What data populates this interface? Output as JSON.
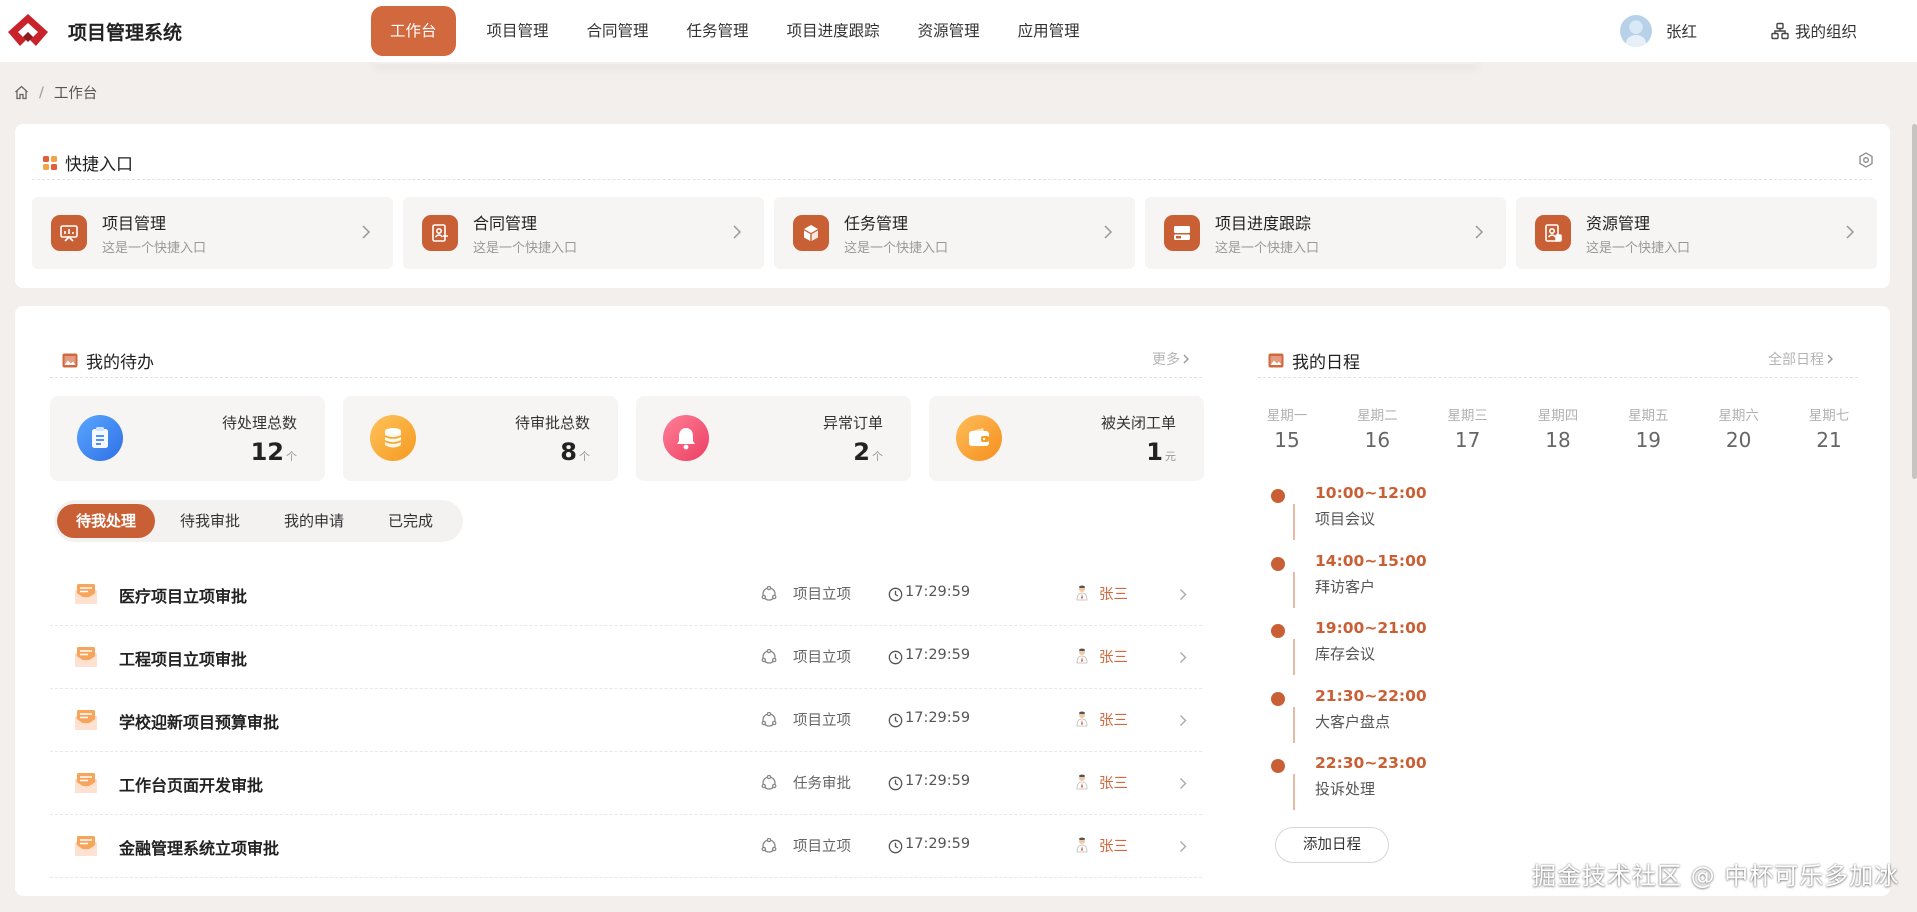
{
  "app": {
    "title": "项目管理系统"
  },
  "nav": {
    "items": [
      "工作台",
      "项目管理",
      "合同管理",
      "任务管理",
      "项目进度跟踪",
      "资源管理",
      "应用管理"
    ]
  },
  "user": {
    "name": "张红",
    "org_label": "我的组织"
  },
  "breadcrumb": {
    "current": "工作台",
    "separator": "/"
  },
  "quick_entry": {
    "title": "快捷入口",
    "items": [
      {
        "title": "项目管理",
        "desc": "这是一个快捷入口",
        "icon": "chart-board-icon"
      },
      {
        "title": "合同管理",
        "desc": "这是一个快捷入口",
        "icon": "contract-icon"
      },
      {
        "title": "任务管理",
        "desc": "这是一个快捷入口",
        "icon": "cube-icon"
      },
      {
        "title": "项目进度跟踪",
        "desc": "这是一个快捷入口",
        "icon": "progress-icon"
      },
      {
        "title": "资源管理",
        "desc": "这是一个快捷入口",
        "icon": "resource-icon"
      }
    ]
  },
  "todo": {
    "title": "我的待办",
    "more": "更多",
    "stats": [
      {
        "label": "待处理总数",
        "value": "12",
        "unit": "个",
        "color": "#3b82f6"
      },
      {
        "label": "待审批总数",
        "value": "8",
        "unit": "个",
        "color": "#f5a524"
      },
      {
        "label": "异常订单",
        "value": "2",
        "unit": "个",
        "color": "#f0506e"
      },
      {
        "label": "被关闭工单",
        "value": "1",
        "unit": "元",
        "color": "#f59e24"
      }
    ],
    "tabs": [
      "待我处理",
      "待我审批",
      "我的申请",
      "已完成"
    ],
    "rows": [
      {
        "title": "医疗项目立项审批",
        "type": "项目立项",
        "time": "17:29:59",
        "person": "张三"
      },
      {
        "title": "工程项目立项审批",
        "type": "项目立项",
        "time": "17:29:59",
        "person": "张三"
      },
      {
        "title": "学校迎新项目预算审批",
        "type": "项目立项",
        "time": "17:29:59",
        "person": "张三"
      },
      {
        "title": "工作台页面开发审批",
        "type": "任务审批",
        "time": "17:29:59",
        "person": "张三"
      },
      {
        "title": "金融管理系统立项审批",
        "type": "项目立项",
        "time": "17:29:59",
        "person": "张三"
      }
    ]
  },
  "schedule": {
    "title": "我的日程",
    "more": "全部日程",
    "week": [
      {
        "name": "星期一",
        "day": "15"
      },
      {
        "name": "星期二",
        "day": "16"
      },
      {
        "name": "星期三",
        "day": "17"
      },
      {
        "name": "星期四",
        "day": "18"
      },
      {
        "name": "星期五",
        "day": "19"
      },
      {
        "name": "星期六",
        "day": "20"
      },
      {
        "name": "星期七",
        "day": "21"
      }
    ],
    "events": [
      {
        "time": "10:00~12:00",
        "title": "项目会议"
      },
      {
        "time": "14:00~15:00",
        "title": "拜访客户"
      },
      {
        "time": "19:00~21:00",
        "title": "库存会议"
      },
      {
        "time": "21:30~22:00",
        "title": "大客户盘点"
      },
      {
        "time": "22:30~23:00",
        "title": "投诉处理"
      }
    ],
    "add_label": "添加日程"
  },
  "watermark": "掘金技术社区 @ 中杯可乐多加冰",
  "colors": {
    "accent": "#c95f35",
    "nav_active": "#d2683e",
    "background": "#f3efec"
  }
}
